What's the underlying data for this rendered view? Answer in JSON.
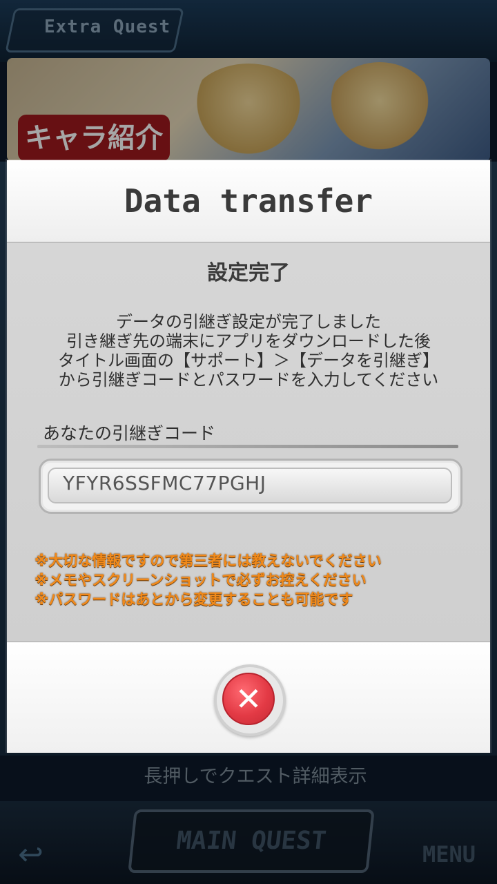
{
  "background": {
    "header_title": "Extra Quest",
    "banner_badge": "キャラ紹介",
    "hint": "長押しでクエスト詳細表示",
    "main_quest_label": "MAIN QUEST",
    "menu_label": "MENU",
    "back_icon": "back-arrow-icon"
  },
  "modal": {
    "title": "Data transfer",
    "status_title": "設定完了",
    "description": [
      "データの引継ぎ設定が完了しました",
      "引き継ぎ先の端末にアプリをダウンロードした後",
      "タイトル画面の【サポート】＞【データを引継ぎ】",
      "から引継ぎコードとパスワードを入力してください"
    ],
    "code_label": "あなたの引継ぎコード",
    "code_value": "YFYR6SSFMC77PGHJ",
    "warnings": [
      "※大切な情報ですので第三者には教えないでください",
      "※メモやスクリーンショットで必ずお控えください",
      "※パスワードはあとから変更することも可能です"
    ],
    "close_icon": "close-icon",
    "accent_color": "#e33a45",
    "warning_color": "#f28a1a"
  }
}
